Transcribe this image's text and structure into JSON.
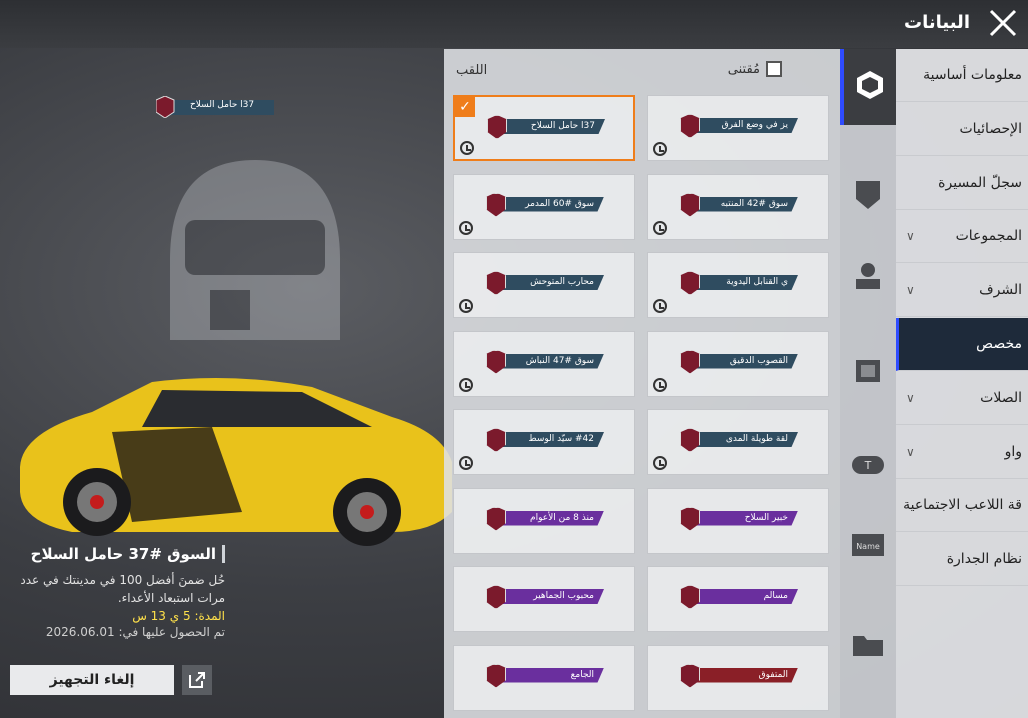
{
  "header": {
    "title": "البيانات"
  },
  "preview": {
    "badge_text": "37ا حامل السلاح",
    "item_name": "السوق #37 حامل السلاح",
    "description": "حُل ضمنَ أفضل 100 في مدينتك في عدد مرات استبعاد الأعداء.",
    "duration": "المدة: 5 ي 13 س",
    "obtained": "تم الحصول عليها في: 2026.06.01",
    "unequip_label": "إلغاء التجهيز"
  },
  "panel": {
    "owned_label": "مُقتنى",
    "section_label": "اللقب",
    "cards": [
      {
        "text": "37ا حامل السلاح",
        "style": "blue",
        "timed": true,
        "selected": true
      },
      {
        "text": "يز في وضع الفرق",
        "style": "blue",
        "timed": true,
        "selected": false
      },
      {
        "text": "سوق #60 المدمر",
        "style": "blue",
        "timed": true,
        "selected": false
      },
      {
        "text": "سوق #42 المنتبه",
        "style": "blue",
        "timed": true,
        "selected": false
      },
      {
        "text": "محارب المتوحش",
        "style": "blue",
        "timed": true,
        "selected": false
      },
      {
        "text": "ي القنابل اليدوية",
        "style": "blue",
        "timed": true,
        "selected": false
      },
      {
        "text": "سوق #47 النباش",
        "style": "blue",
        "timed": true,
        "selected": false
      },
      {
        "text": "القصوب الدقيق",
        "style": "blue",
        "timed": true,
        "selected": false
      },
      {
        "text": "#42 سيّد الوسط",
        "style": "blue",
        "timed": true,
        "selected": false
      },
      {
        "text": "لقة طويلة المدى",
        "style": "blue",
        "timed": true,
        "selected": false
      },
      {
        "text": "منذ 8 من الأعوام",
        "style": "purple",
        "timed": false,
        "selected": false
      },
      {
        "text": "خبير السلاح",
        "style": "purple",
        "timed": false,
        "selected": false
      },
      {
        "text": "محبوب الجماهير",
        "style": "purple",
        "timed": false,
        "selected": false
      },
      {
        "text": "مسالم",
        "style": "purple",
        "timed": false,
        "selected": false
      },
      {
        "text": "الجامع",
        "style": "purple",
        "timed": false,
        "selected": false
      },
      {
        "text": "المتفوق",
        "style": "red",
        "timed": false,
        "selected": false
      }
    ]
  },
  "tabs": [
    {
      "name": "title-tab",
      "icon": "hexagon-badge-icon",
      "active": true
    },
    {
      "name": "shield-tab",
      "icon": "shield-icon",
      "active": false
    },
    {
      "name": "avatar-tab",
      "icon": "person-icon",
      "active": false
    },
    {
      "name": "frame-tab",
      "icon": "frame-icon",
      "active": false
    },
    {
      "name": "tag-tab",
      "icon": "tag-icon",
      "active": false
    },
    {
      "name": "nameplate-tab",
      "icon": "nameplate-icon",
      "active": false
    },
    {
      "name": "folder-tab",
      "icon": "folder-icon",
      "active": false
    }
  ],
  "menu": [
    {
      "label": "معلومات أساسية",
      "chevron": false,
      "active": false
    },
    {
      "label": "الإحصائيات",
      "chevron": false,
      "active": false
    },
    {
      "label": "سجلّ المسيرة",
      "chevron": false,
      "active": false
    },
    {
      "label": "المجموعات",
      "chevron": true,
      "active": false
    },
    {
      "label": "الشرف",
      "chevron": true,
      "active": false
    },
    {
      "label": "مخصص",
      "chevron": false,
      "active": true
    },
    {
      "label": "الصلات",
      "chevron": true,
      "active": false
    },
    {
      "label": "واو",
      "chevron": true,
      "active": false
    },
    {
      "label": "قة اللاعب الاجتماعية",
      "chevron": false,
      "active": false
    },
    {
      "label": "نظام الجدارة",
      "chevron": false,
      "active": false
    }
  ]
}
